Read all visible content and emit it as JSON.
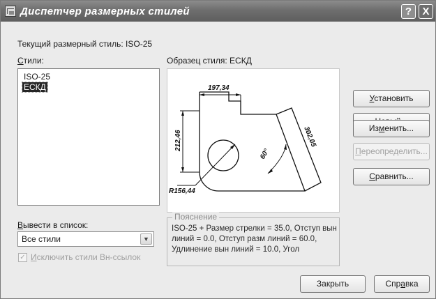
{
  "window": {
    "title": "Диспетчер размерных стилей"
  },
  "current_style": {
    "text": "Текущий размерный стиль: ISO-25"
  },
  "styles": {
    "label": "Стили:",
    "items": [
      {
        "label": "ISO-25",
        "selected": false
      },
      {
        "label": "ЕСКД",
        "selected": true
      }
    ]
  },
  "preview": {
    "label": "Образец стиля: ЕСКД",
    "dims": {
      "top": "197,34",
      "left": "212,46",
      "right": "302,05",
      "angle": "60°",
      "radius": "R156,44"
    }
  },
  "explanation": {
    "legend": "Пояснение",
    "text": "ISO-25 + Размер стрелки = 35.0, Отступ вын линий = 0.0, Отступ разм линий = 60.0, Удлинение вын линий = 10.0, Угол"
  },
  "list_filter": {
    "label": "Вывести в список:",
    "value": "Все стили",
    "exclude_xref": {
      "label": "Исключить стили Вн-ссылок",
      "checked": true,
      "enabled": false
    }
  },
  "buttons": {
    "set": "Установить",
    "new": "Новый...",
    "modify": "Изменить...",
    "override": "Переопределить...",
    "compare": "Сравнить...",
    "close": "Закрыть",
    "help": "Справка"
  },
  "title_buttons": {
    "help": "?",
    "close": "X"
  }
}
